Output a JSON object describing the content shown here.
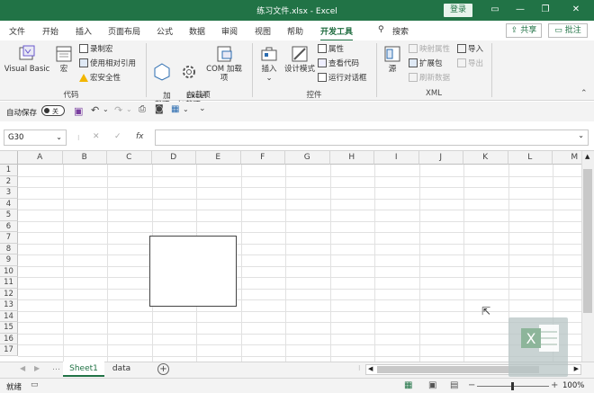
{
  "window": {
    "title": "练习文件.xlsx  -  Excel",
    "login_label": "登录"
  },
  "tabs": [
    "文件",
    "开始",
    "插入",
    "页面布局",
    "公式",
    "数据",
    "审阅",
    "视图",
    "帮助",
    "开发工具",
    "搜索"
  ],
  "active_tab": "开发工具",
  "share_label": "共享",
  "comments_label": "批注",
  "ribbon": {
    "code": {
      "label": "代码",
      "visual_basic": "Visual Basic",
      "macros": "宏",
      "record_macro": "录制宏",
      "relative_ref": "使用相对引用",
      "macro_security": "宏安全性"
    },
    "addins": {
      "label": "加载项",
      "addins": "加\n载项",
      "excel_addins": "Excel\n加载项",
      "com_addins": "COM 加载项"
    },
    "controls": {
      "label": "控件",
      "insert": "插入",
      "design_mode": "设计模式",
      "properties": "属性",
      "view_code": "查看代码",
      "run_dialog": "运行对话框"
    },
    "xml": {
      "label": "XML",
      "source": "源",
      "map_properties": "映射属性",
      "expansion_packs": "扩展包",
      "refresh_data": "刷新数据",
      "import": "导入",
      "export": "导出"
    }
  },
  "qat": {
    "autosave_label": "自动保存",
    "toggle_state": "关"
  },
  "name_box": "G30",
  "fx_label": "fx",
  "columns": [
    "A",
    "B",
    "C",
    "D",
    "E",
    "F",
    "G",
    "H",
    "I",
    "J",
    "K",
    "L",
    "M"
  ],
  "rows": [
    "1",
    "2",
    "3",
    "4",
    "5",
    "6",
    "7",
    "8",
    "9",
    "10",
    "11",
    "12",
    "13",
    "14",
    "15",
    "16",
    "17"
  ],
  "sheets": [
    "Sheet1",
    "data"
  ],
  "active_sheet": "Sheet1",
  "status": {
    "ready": "就绪",
    "zoom": "100%"
  },
  "colors": {
    "accent": "#217346"
  }
}
